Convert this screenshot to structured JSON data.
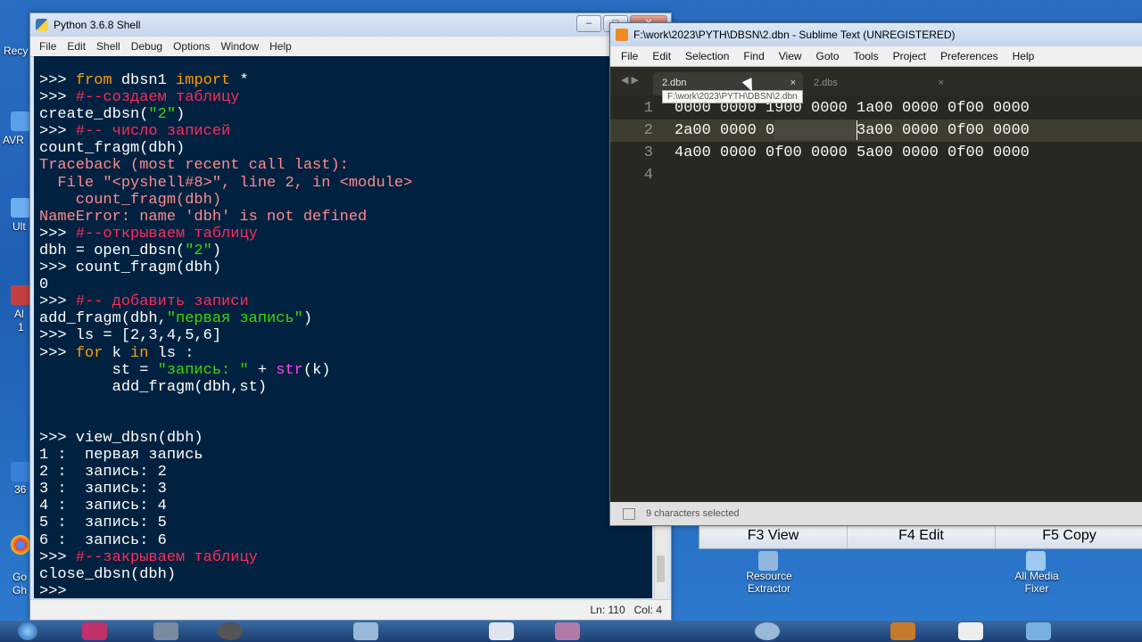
{
  "desktop": {
    "left_labels": [
      "Recy",
      "AVR",
      "Ult",
      "Al",
      "1",
      "36",
      "Go",
      "Gh"
    ],
    "icons": [
      {
        "label1": "Resource",
        "label2": "Extractor"
      },
      {
        "label1": "All Media",
        "label2": "Fixer"
      }
    ]
  },
  "python_window": {
    "title": "Python 3.6.8 Shell",
    "menu": [
      "File",
      "Edit",
      "Shell",
      "Debug",
      "Options",
      "Window",
      "Help"
    ],
    "status": {
      "line": "Ln: 110",
      "col": "Col: 4"
    },
    "lines": [
      [
        {
          "t": ">>> ",
          "c": "p"
        },
        {
          "t": "from",
          "c": "kw"
        },
        {
          "t": " dbsn1 ",
          "c": "p"
        },
        {
          "t": "import",
          "c": "kw"
        },
        {
          "t": " *",
          "c": "p"
        }
      ],
      [
        {
          "t": ">>> ",
          "c": "p"
        },
        {
          "t": "#--создаем таблицу",
          "c": "cm"
        }
      ],
      [
        {
          "t": "create_dbsn(",
          "c": "p"
        },
        {
          "t": "\"2\"",
          "c": "st"
        },
        {
          "t": ")",
          "c": "p"
        }
      ],
      [
        {
          "t": ">>> ",
          "c": "p"
        },
        {
          "t": "#-- число записей",
          "c": "cm"
        }
      ],
      [
        {
          "t": "count_fragm(dbh)",
          "c": "p"
        }
      ],
      [
        {
          "t": "Traceback (most recent call last):",
          "c": "err"
        }
      ],
      [
        {
          "t": "  File \"<pyshell#8>\", line 2, in <module>",
          "c": "err"
        }
      ],
      [
        {
          "t": "    count_fragm(dbh)",
          "c": "err"
        }
      ],
      [
        {
          "t": "NameError: name 'dbh' is not defined",
          "c": "err"
        }
      ],
      [
        {
          "t": ">>> ",
          "c": "p"
        },
        {
          "t": "#--открываем таблицу",
          "c": "cm"
        }
      ],
      [
        {
          "t": "dbh = open_dbsn(",
          "c": "p"
        },
        {
          "t": "\"2\"",
          "c": "st"
        },
        {
          "t": ")",
          "c": "p"
        }
      ],
      [
        {
          "t": ">>> count_fragm(dbh)",
          "c": "p"
        }
      ],
      [
        {
          "t": "0",
          "c": "p"
        }
      ],
      [
        {
          "t": ">>> ",
          "c": "p"
        },
        {
          "t": "#-- добавить записи",
          "c": "cm"
        }
      ],
      [
        {
          "t": "add_fragm(dbh,",
          "c": "p"
        },
        {
          "t": "\"первая запись\"",
          "c": "st"
        },
        {
          "t": ")",
          "c": "p"
        }
      ],
      [
        {
          "t": ">>> ls = [2,3,4,5,6]",
          "c": "p"
        }
      ],
      [
        {
          "t": ">>> ",
          "c": "p"
        },
        {
          "t": "for",
          "c": "kw"
        },
        {
          "t": " k ",
          "c": "p"
        },
        {
          "t": "in",
          "c": "kw"
        },
        {
          "t": " ls :",
          "c": "p"
        }
      ],
      [
        {
          "t": "        st = ",
          "c": "p"
        },
        {
          "t": "\"запись: \"",
          "c": "st"
        },
        {
          "t": " + ",
          "c": "p"
        },
        {
          "t": "str",
          "c": "bi"
        },
        {
          "t": "(k)",
          "c": "p"
        }
      ],
      [
        {
          "t": "        add_fragm(dbh,st)",
          "c": "p"
        }
      ],
      [],
      [],
      [
        {
          "t": ">>> view_dbsn(dbh)",
          "c": "p"
        }
      ],
      [
        {
          "t": "1 :  первая запись",
          "c": "p"
        }
      ],
      [
        {
          "t": "2 :  запись: 2",
          "c": "p"
        }
      ],
      [
        {
          "t": "3 :  запись: 3",
          "c": "p"
        }
      ],
      [
        {
          "t": "4 :  запись: 4",
          "c": "p"
        }
      ],
      [
        {
          "t": "5 :  запись: 5",
          "c": "p"
        }
      ],
      [
        {
          "t": "6 :  запись: 6",
          "c": "p"
        }
      ],
      [
        {
          "t": ">>> ",
          "c": "p"
        },
        {
          "t": "#--закрываем таблицу",
          "c": "cm"
        }
      ],
      [
        {
          "t": "close_dbsn(dbh)",
          "c": "p"
        }
      ],
      [
        {
          "t": ">>> ",
          "c": "p"
        }
      ]
    ]
  },
  "sublime_window": {
    "title": "F:\\work\\2023\\PYTH\\DBSN\\2.dbn - Sublime Text (UNREGISTERED)",
    "menu": [
      "File",
      "Edit",
      "Selection",
      "Find",
      "View",
      "Goto",
      "Tools",
      "Project",
      "Preferences",
      "Help"
    ],
    "tabs": [
      {
        "label": "2.dbn",
        "active": true
      },
      {
        "label": "2.dbs",
        "active": false
      }
    ],
    "tab_close": "×",
    "tooltip": "F:\\work\\2023\\PYTH\\DBSN\\2.dbn",
    "editor_lines": [
      {
        "num": "1",
        "text": "0000 0000 1900 0000 1a00 0000 0f00 0000"
      },
      {
        "num": "2",
        "text": "2a00 0000 0f00 0000 3a00 0000 0f00 0000"
      },
      {
        "num": "3",
        "text": "4a00 0000 0f00 0000 5a00 0000 0f00 0000"
      },
      {
        "num": "4",
        "text": ""
      }
    ],
    "status": "9 characters selected"
  },
  "file_manager": {
    "keys": [
      "F3 View",
      "F4 Edit",
      "F5 Copy"
    ]
  }
}
